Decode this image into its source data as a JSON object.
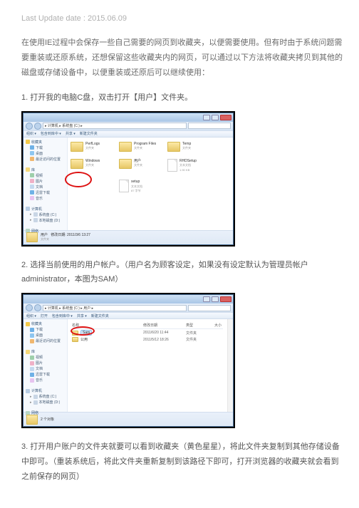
{
  "update_date": "Last Update date : 2015.06.09",
  "intro": "在使用IE过程中会保存一些自己需要的网页到收藏夹，以便需要使用。但有时由于系统问题需要重装或还原系统，还想保留这些收藏夹内的网页，可以通过以下方法将收藏夹拷贝到其他的磁盘或存储设备中，以便重装或还原后可以继续使用：",
  "step1": "1. 打开我的电脑C盘，双击打开【用户】文件夹。",
  "step2": "2. 选择当前使用的用户帐户。（用户名为顾客设定，如果没有设定默认为管理员帐户administrator，本图为SAM）",
  "step3": "3. 打开用户账户的文件夹就要可以看到收藏夹（黄色星星），将此文件夹复制到其他存储设备中即可。（重装系统后，将此文件夹重新复制到该路径下即可，打开浏览器的收藏夹就会看到之前保存的网页）",
  "explorer1": {
    "crumb": "▸ 计算机 ▸ 系统盘 (C:) ▸",
    "search_placeholder": "搜索",
    "toolbar": {
      "org": "组织 ▾",
      "inc": "包含到库中 ▾",
      "share": "共享 ▾",
      "new": "新建文件夹"
    },
    "sidebar": {
      "fav": "收藏夹",
      "dl": "下载",
      "desk": "桌面",
      "recent": "最近访问的位置",
      "lib": "库",
      "vdo": "视频",
      "img": "图片",
      "doc": "文档",
      "mus": "迅雷下载",
      "mus2": "音乐",
      "comp": "计算机",
      "hdd1": "系统盘 (C:)",
      "hdd2": "本地磁盘 (D:)",
      "net": "网络"
    },
    "folders": {
      "perflogs": "PerfLogs",
      "progfiles": "Program Files",
      "temp": "Temp",
      "windows": "Windows",
      "users": "用户",
      "sub_folder": "文件夹",
      "rhd": "RHDSetup",
      "rhd_sub1": "文本文档",
      "rhd_sub2": "1.90 KB",
      "setup": "setup",
      "setup_sub1": "文本文档",
      "setup_sub2": "87 字节"
    },
    "status": {
      "name": "用户",
      "date": "修改日期: 2011/3/6 13:27",
      "type": "文件夹"
    }
  },
  "explorer2": {
    "crumb": "▸ 计算机 ▸ 系统盘 (C:) ▸ 用户 ▸",
    "search_placeholder": "搜索 用户",
    "toolbar": {
      "org": "组织 ▾",
      "open": "打开",
      "inc": "包含到库中 ▾",
      "share": "共享 ▾",
      "new": "新建文件夹"
    },
    "cols": {
      "name": "名称",
      "date": "修改日期",
      "type": "类型",
      "size": "大小"
    },
    "rows": {
      "r0": {
        "name": "Sam",
        "date": "2011/6/20 11:44",
        "type": "文件夹"
      },
      "r1": {
        "name": "公用",
        "date": "2011/5/12 18:26",
        "type": "文件夹"
      }
    },
    "status": {
      "count": "2 个对象"
    }
  }
}
